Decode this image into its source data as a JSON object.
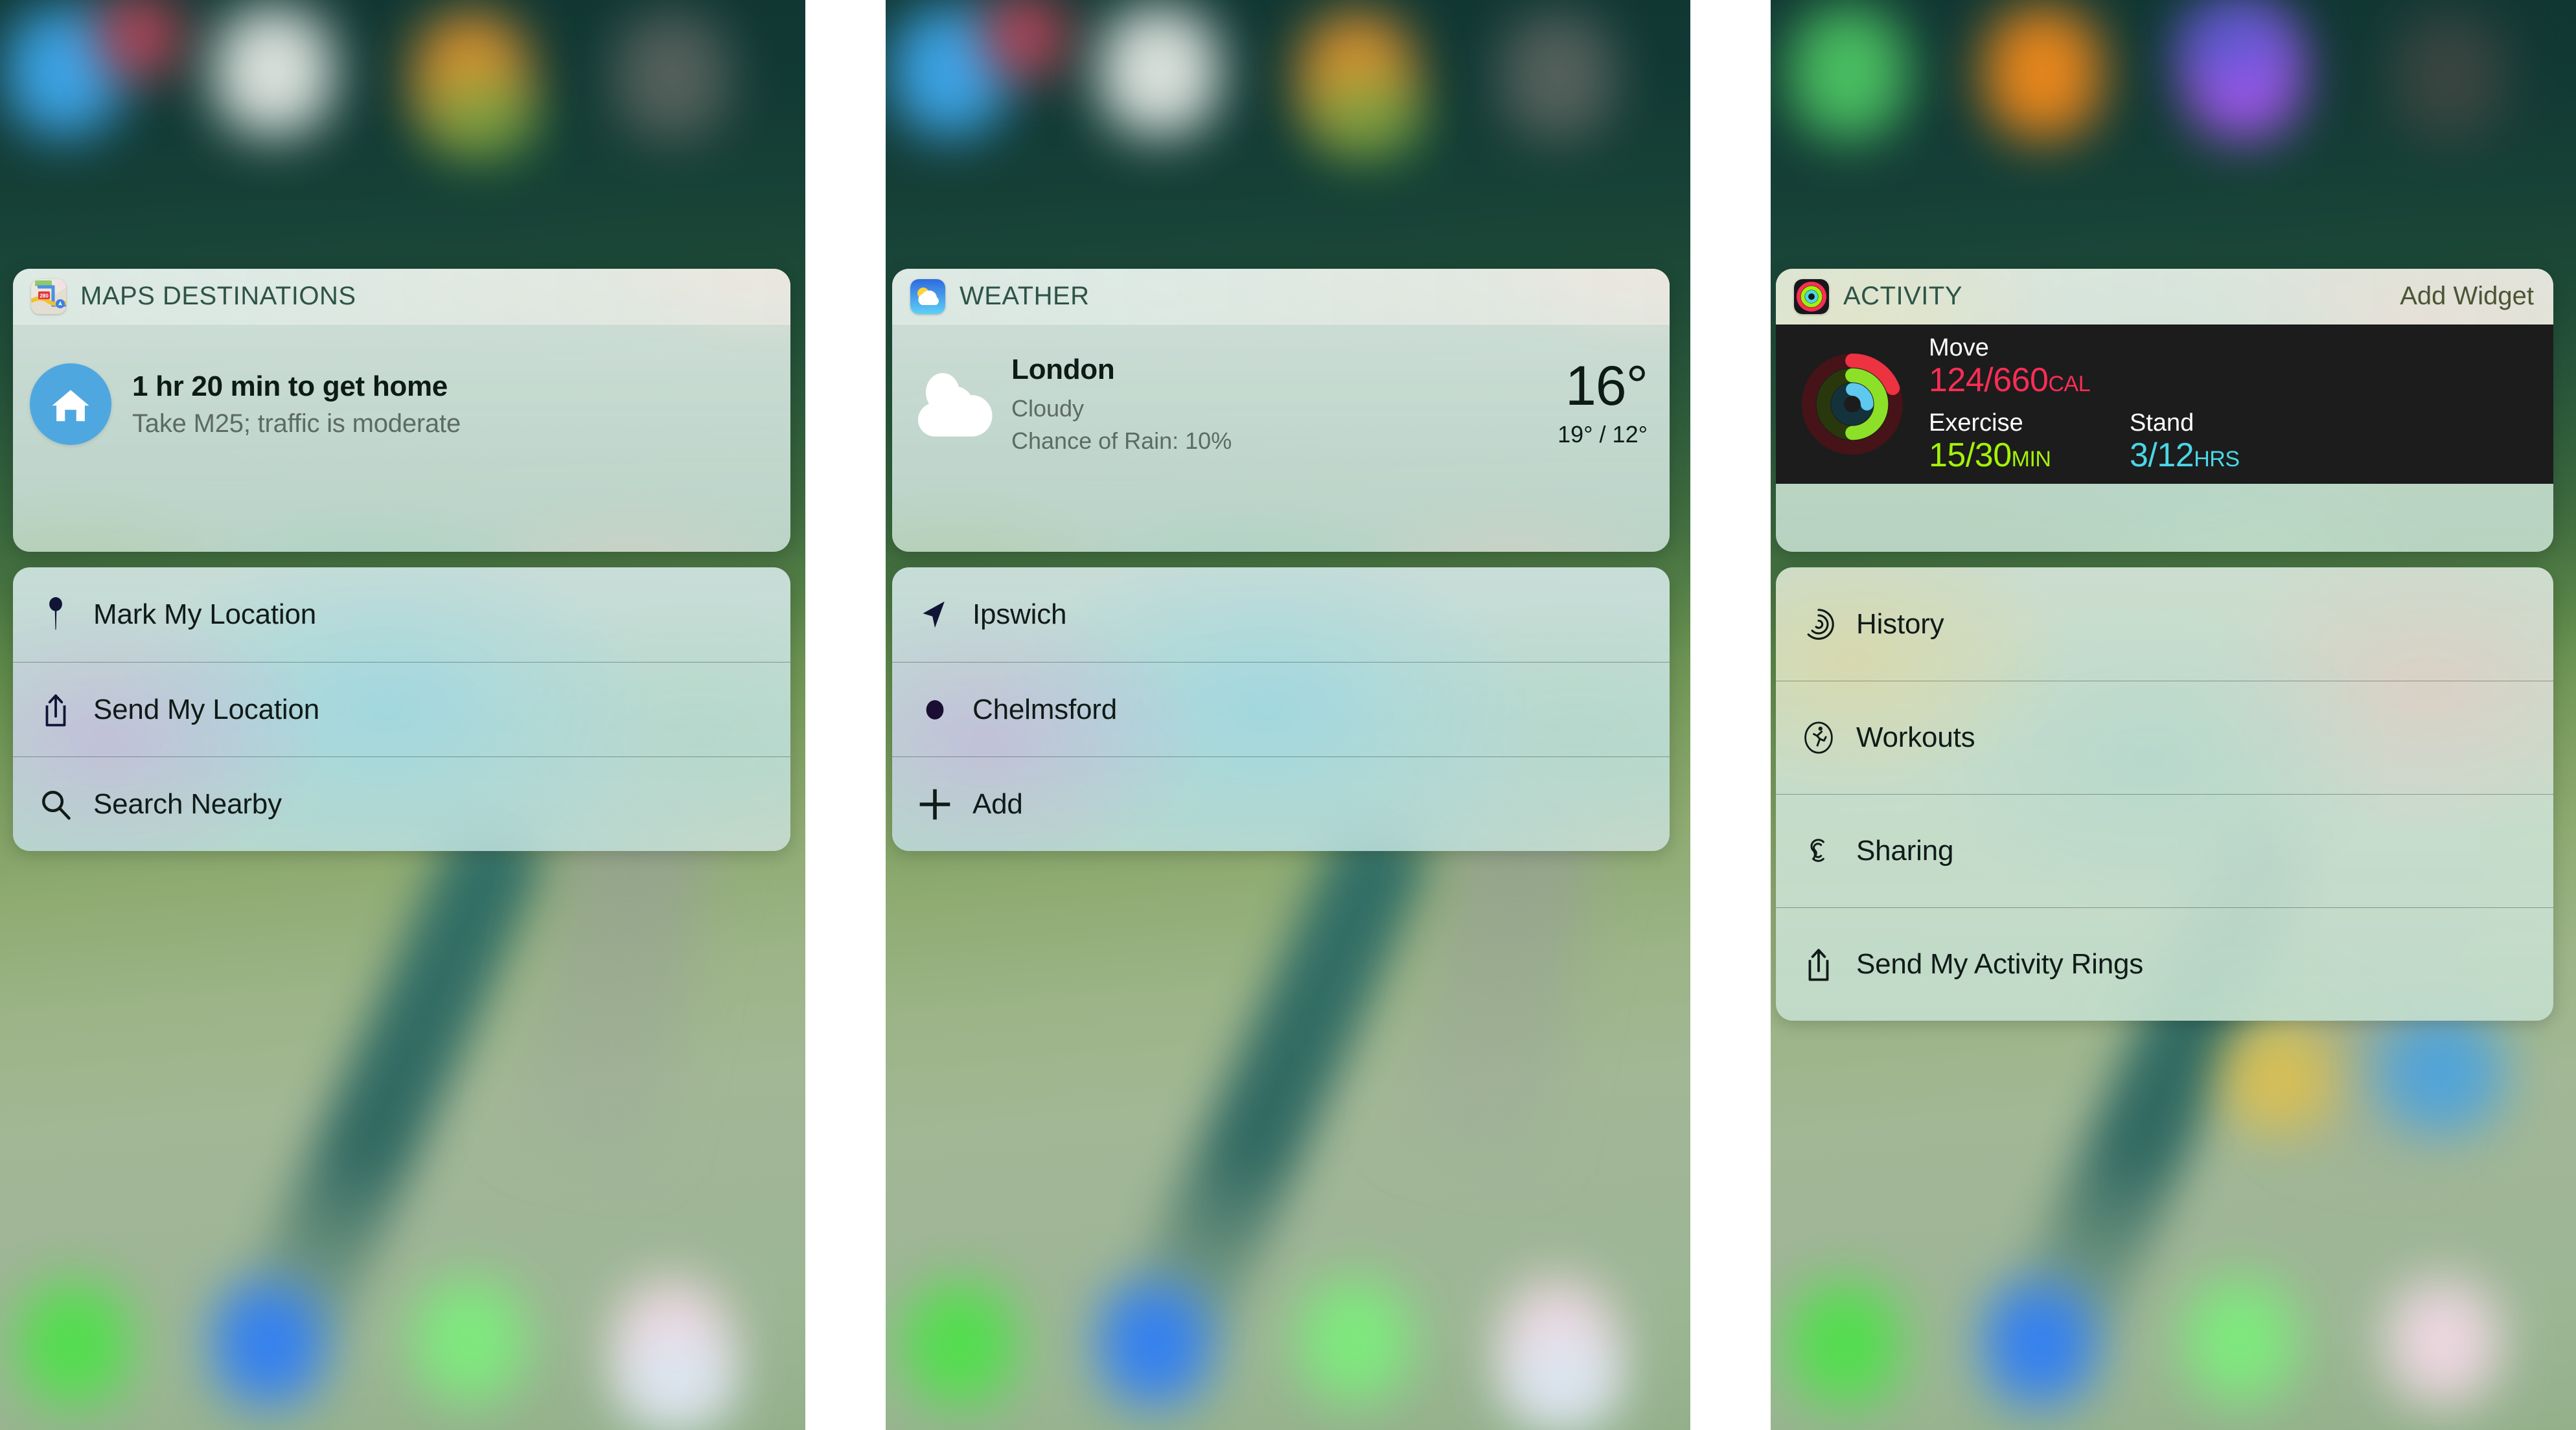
{
  "screens": [
    {
      "id": "maps",
      "widget": {
        "app_icon": "maps-app-icon",
        "title": "MAPS DESTINATIONS",
        "add_widget_label": "",
        "destination_icon": "home-icon",
        "eta": "1 hr 20 min to get home",
        "detail": "Take M25; traffic is moderate"
      },
      "actions": [
        {
          "icon": "pin-icon",
          "label": "Mark My Location"
        },
        {
          "icon": "share-icon",
          "label": "Send My Location"
        },
        {
          "icon": "search-icon",
          "label": "Search Nearby"
        }
      ]
    },
    {
      "id": "weather",
      "widget": {
        "app_icon": "weather-app-icon",
        "title": "WEATHER",
        "add_widget_label": "",
        "condition_icon": "cloud-icon",
        "city": "London",
        "condition": "Cloudy",
        "rain": "Chance of Rain: 10%",
        "temperature": "16°",
        "high_low": "19° / 12°"
      },
      "actions": [
        {
          "icon": "location-arrow-icon",
          "label": "Ipswich"
        },
        {
          "icon": "dot-icon",
          "label": "Chelmsford"
        },
        {
          "icon": "plus-icon",
          "label": "Add"
        }
      ]
    },
    {
      "id": "activity",
      "widget": {
        "app_icon": "activity-app-icon",
        "title": "ACTIVITY",
        "add_widget_label": "Add Widget",
        "rings_icon": "activity-rings-icon",
        "move_label": "Move",
        "move_value": "124/660",
        "move_unit": "CAL",
        "exercise_label": "Exercise",
        "exercise_value": "15/30",
        "exercise_unit": "MIN",
        "stand_label": "Stand",
        "stand_value": "3/12",
        "stand_unit": "HRS"
      },
      "actions": [
        {
          "icon": "activity-rings-outline-icon",
          "label": "History"
        },
        {
          "icon": "runner-icon",
          "label": "Workouts"
        },
        {
          "icon": "sharing-icon",
          "label": "Sharing"
        },
        {
          "icon": "share-icon",
          "label": "Send My Activity Rings"
        }
      ]
    }
  ],
  "colors": {
    "move_ring": "#fa2d55",
    "exercise_ring": "#a3f308",
    "stand_ring": "#4ad7e8",
    "widget_title": "#2e5448",
    "add_widget": "#4b5534",
    "home_circle": "#4fa7e0",
    "activity_bg": "#1c1c1c",
    "panel_gap": "#ffffff"
  }
}
